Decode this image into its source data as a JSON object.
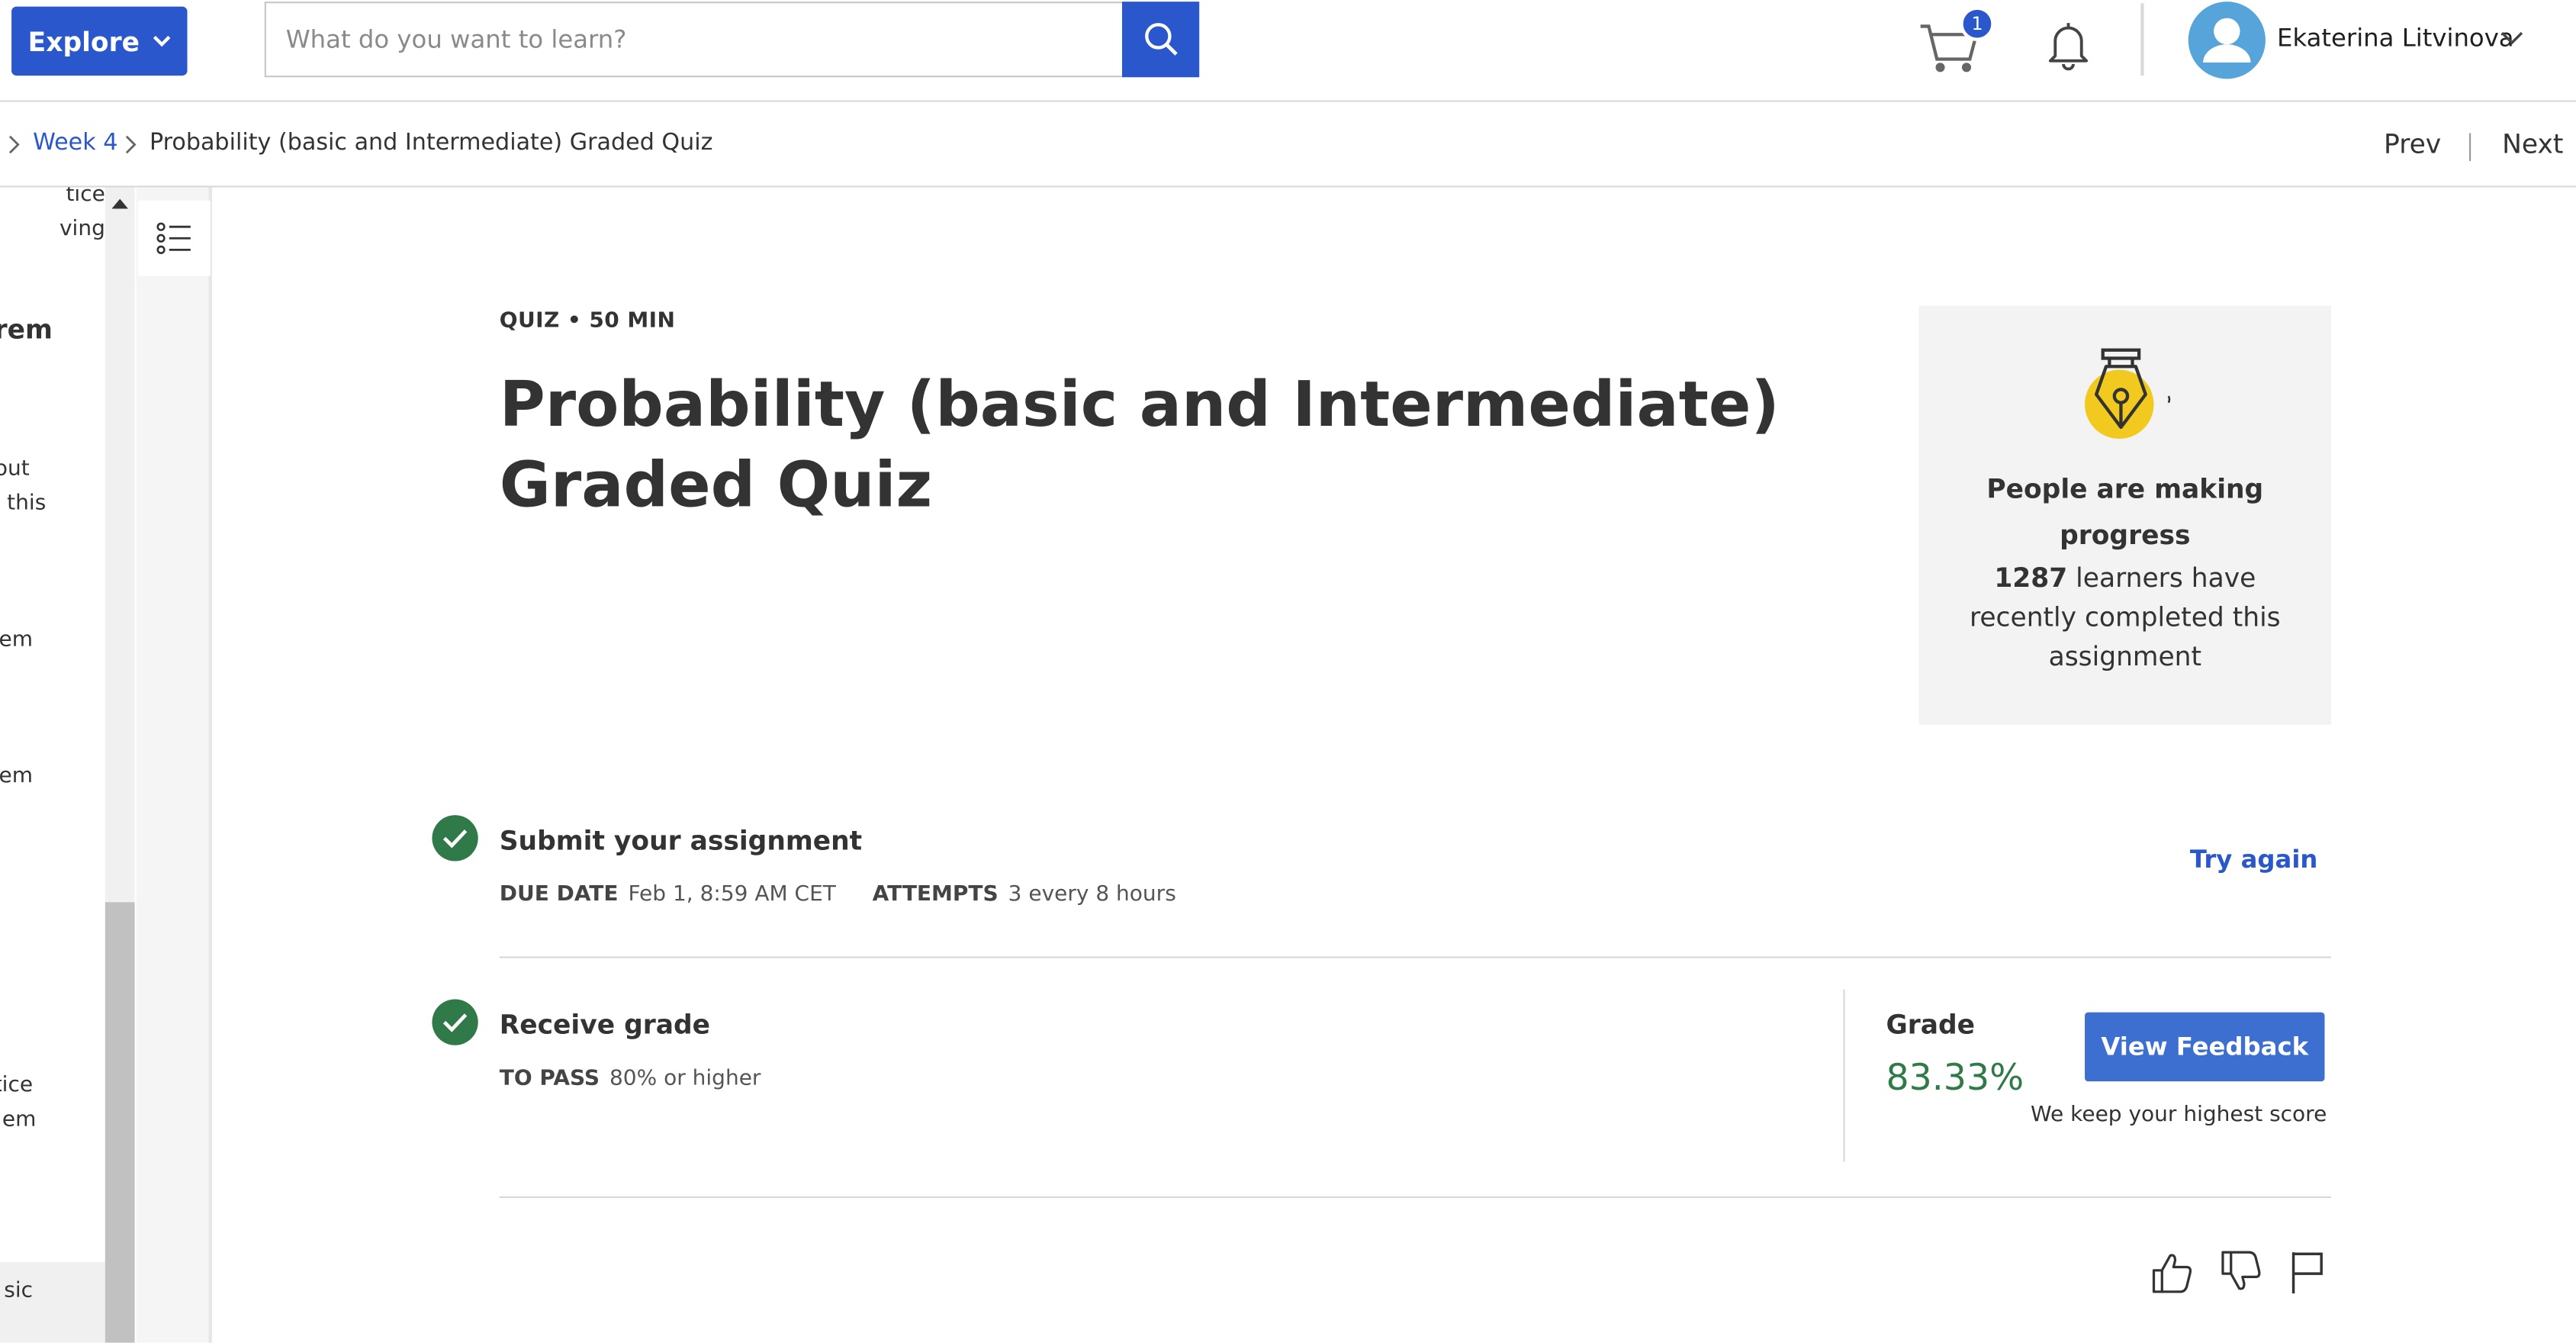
{
  "header": {
    "explore_label": "Explore",
    "search_placeholder": "What do you want to learn?",
    "cart_count": "1",
    "username": "Ekaterina Litvinova"
  },
  "breadcrumb": {
    "week": "Week 4",
    "current": "Probability (basic and Intermediate) Graded Quiz",
    "prev": "Prev",
    "next": "Next"
  },
  "sidebar": {
    "fragments": [
      "tice",
      "ving",
      "rem",
      "out",
      "this",
      "em",
      "em",
      "tice",
      "em",
      "sic"
    ]
  },
  "quiz": {
    "meta": "QUIZ • 50 MIN",
    "title": "Probability (basic and Intermediate) Graded Quiz"
  },
  "progress_card": {
    "heading": "People are making progress",
    "count": "1287",
    "body": " learners have recently completed this assignment"
  },
  "submit": {
    "title": "Submit your assignment",
    "due_label": "DUE DATE",
    "due_value": "Feb 1, 8:59 AM CET",
    "attempts_label": "ATTEMPTS",
    "attempts_value": "3 every 8 hours",
    "try_again": "Try again"
  },
  "receive": {
    "title": "Receive grade",
    "pass_label": "TO PASS",
    "pass_value": "80% or higher",
    "grade_label": "Grade",
    "grade_value": "83.33%",
    "feedback_button": "View Feedback",
    "keep_note": "We keep your highest score"
  },
  "colors": {
    "brand_blue": "#2a58cc",
    "success_green": "#2f7a48",
    "pen_yellow": "#f2c91f"
  },
  "icons": [
    "chevron-down-icon",
    "search-icon",
    "cart-icon",
    "bell-icon",
    "user-avatar-icon",
    "chevron-right-icon",
    "list-icon",
    "pen-icon",
    "check-icon",
    "thumbs-up-icon",
    "thumbs-down-icon",
    "flag-icon"
  ]
}
